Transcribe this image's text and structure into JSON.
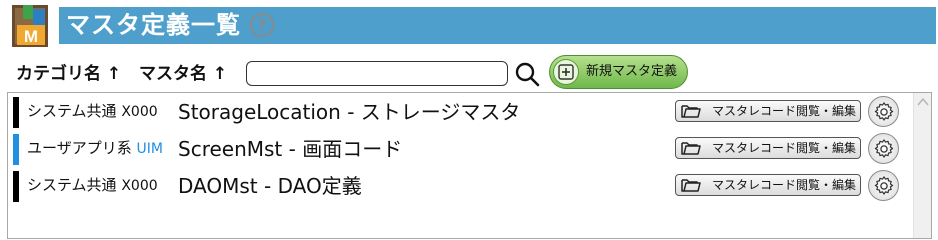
{
  "header": {
    "title": "マスタ定義一覧",
    "app_icon_letter": "M",
    "help_symbol": "?"
  },
  "toolbar": {
    "sort_category": "カテゴリ名 ↑",
    "sort_master": "マスタ名 ↑",
    "search_value": "",
    "search_placeholder": "",
    "new_button_label": "新規マスタ定義"
  },
  "colors": {
    "title_bar": "#4e9fcb",
    "marker_black": "#000000",
    "marker_blue": "#1f90e0",
    "uim_text": "#1f90e0",
    "new_button": "#6fb84a"
  },
  "rows": [
    {
      "category": "システム共通",
      "category_code": "X000",
      "name": "StorageLocation - ストレージマスタ",
      "marker_color": "#000000",
      "code_color": "#111111",
      "edit_label": "マスタレコード閲覧・編集"
    },
    {
      "category": "ユーザアプリ系",
      "category_code": "UIM",
      "name": "ScreenMst - 画面コード",
      "marker_color": "#1f90e0",
      "code_color": "#1f90e0",
      "edit_label": "マスタレコード閲覧・編集"
    },
    {
      "category": "システム共通",
      "category_code": "X000",
      "name": "DAOMst - DAO定義",
      "marker_color": "#000000",
      "code_color": "#111111",
      "edit_label": "マスタレコード閲覧・編集"
    }
  ]
}
